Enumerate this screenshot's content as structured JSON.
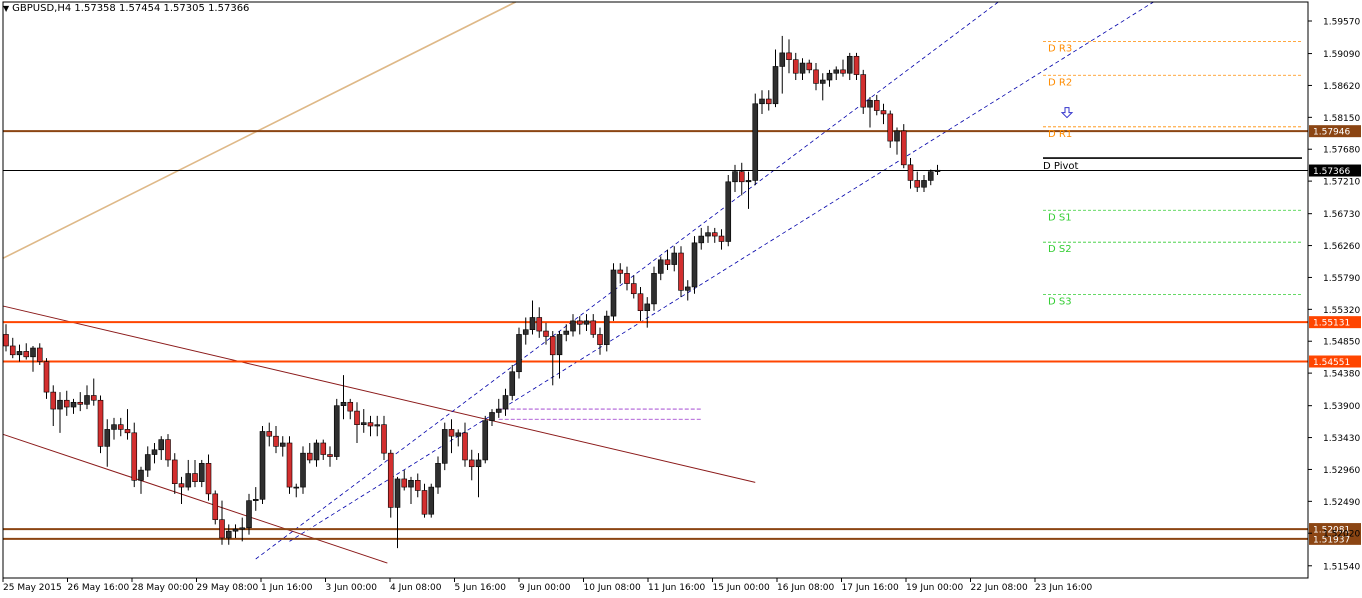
{
  "chart_data": {
    "type": "candlestick",
    "symbol": "GBPUSD,H4",
    "ohlc_header": [
      "1.57358",
      "1.57454",
      "1.57305",
      "1.57366"
    ],
    "ylim": [
      1.5136,
      1.5985
    ],
    "y_ticks": [
      "1.59570",
      "1.59090",
      "1.58620",
      "1.58150",
      "1.57680",
      "1.57210",
      "1.56730",
      "1.56260",
      "1.55790",
      "1.55320",
      "1.54850",
      "1.54380",
      "1.53900",
      "1.53430",
      "1.52960",
      "1.52490",
      "1.52020",
      "1.51540"
    ],
    "x_labels": [
      "25 May 2015",
      "26 May 16:00",
      "28 May 00:00",
      "29 May 08:00",
      "1 Jun 16:00",
      "3 Jun 00:00",
      "4 Jun 08:00",
      "5 Jun 16:00",
      "9 Jun 00:00",
      "10 Jun 08:00",
      "11 Jun 16:00",
      "15 Jun 00:00",
      "16 Jun 08:00",
      "17 Jun 16:00",
      "19 Jun 00:00",
      "22 Jun 08:00",
      "23 Jun 16:00"
    ],
    "horizontal_levels": [
      {
        "value": 1.57946,
        "label": "1.57946",
        "color": "#8b4513"
      },
      {
        "value": 1.57366,
        "label": "1.57366",
        "color": "#000000"
      },
      {
        "value": 1.55131,
        "label": "1.55131",
        "color": "#ff4500"
      },
      {
        "value": 1.54551,
        "label": "1.54551",
        "color": "#ff4500"
      },
      {
        "value": 1.52081,
        "label": "1.52081",
        "color": "#8b4513"
      },
      {
        "value": 1.51937,
        "label": "1.51937",
        "color": "#8b4513"
      }
    ],
    "pivots": [
      {
        "label": "D R3",
        "value": 1.5927,
        "color": "#ff8c00"
      },
      {
        "label": "D R2",
        "value": 1.5877,
        "color": "#ff8c00"
      },
      {
        "label": "D R1",
        "value": 1.5801,
        "color": "#ff8c00"
      },
      {
        "label": "D Pivot",
        "value": 1.5755,
        "color": "#000000"
      },
      {
        "label": "D S1",
        "value": 1.5678,
        "color": "#32cd32"
      },
      {
        "label": "D S2",
        "value": 1.5631,
        "color": "#32cd32"
      },
      {
        "label": "D S3",
        "value": 1.5554,
        "color": "#32cd32"
      }
    ],
    "candles": [
      [
        1.5495,
        1.551,
        1.547,
        1.5478
      ],
      [
        1.5478,
        1.549,
        1.546,
        1.5465
      ],
      [
        1.5465,
        1.548,
        1.5455,
        1.547
      ],
      [
        1.547,
        1.5482,
        1.5458,
        1.5462
      ],
      [
        1.5462,
        1.5478,
        1.544,
        1.5475
      ],
      [
        1.5475,
        1.5482,
        1.545,
        1.5455
      ],
      [
        1.5455,
        1.546,
        1.54,
        1.541
      ],
      [
        1.541,
        1.542,
        1.536,
        1.5385
      ],
      [
        1.5385,
        1.541,
        1.535,
        1.5398
      ],
      [
        1.5398,
        1.5412,
        1.5375,
        1.5388
      ],
      [
        1.5388,
        1.54,
        1.5378,
        1.5395
      ],
      [
        1.5395,
        1.541,
        1.5382,
        1.5392
      ],
      [
        1.5392,
        1.542,
        1.5385,
        1.5405
      ],
      [
        1.5405,
        1.543,
        1.539,
        1.5398
      ],
      [
        1.5398,
        1.5405,
        1.532,
        1.533
      ],
      [
        1.533,
        1.537,
        1.53,
        1.5355
      ],
      [
        1.5355,
        1.5372,
        1.534,
        1.5362
      ],
      [
        1.5362,
        1.5372,
        1.5345,
        1.5355
      ],
      [
        1.5355,
        1.5385,
        1.534,
        1.535
      ],
      [
        1.535,
        1.5365,
        1.527,
        1.528
      ],
      [
        1.528,
        1.53,
        1.526,
        1.5295
      ],
      [
        1.5295,
        1.533,
        1.5285,
        1.5318
      ],
      [
        1.5318,
        1.5335,
        1.5305,
        1.5325
      ],
      [
        1.5325,
        1.5345,
        1.531,
        1.534
      ],
      [
        1.534,
        1.5348,
        1.53,
        1.531
      ],
      [
        1.531,
        1.532,
        1.526,
        1.5275
      ],
      [
        1.5275,
        1.5285,
        1.5245,
        1.527
      ],
      [
        1.527,
        1.531,
        1.5265,
        1.529
      ],
      [
        1.529,
        1.531,
        1.527,
        1.5278
      ],
      [
        1.5278,
        1.531,
        1.527,
        1.5305
      ],
      [
        1.5305,
        1.5318,
        1.525,
        1.526
      ],
      [
        1.526,
        1.5265,
        1.5215,
        1.5222
      ],
      [
        1.5222,
        1.525,
        1.5185,
        1.5195
      ],
      [
        1.5195,
        1.5215,
        1.5185,
        1.5205
      ],
      [
        1.5205,
        1.5215,
        1.5195,
        1.5208
      ],
      [
        1.5208,
        1.5225,
        1.519,
        1.521
      ],
      [
        1.521,
        1.526,
        1.52,
        1.525
      ],
      [
        1.525,
        1.527,
        1.5235,
        1.5252
      ],
      [
        1.5252,
        1.536,
        1.5245,
        1.5352
      ],
      [
        1.5352,
        1.5365,
        1.533,
        1.5345
      ],
      [
        1.5345,
        1.536,
        1.532,
        1.533
      ],
      [
        1.533,
        1.5345,
        1.5315,
        1.5335
      ],
      [
        1.5335,
        1.5345,
        1.526,
        1.527
      ],
      [
        1.527,
        1.5275,
        1.5255,
        1.527
      ],
      [
        1.527,
        1.533,
        1.526,
        1.532
      ],
      [
        1.532,
        1.5335,
        1.5305,
        1.531
      ],
      [
        1.531,
        1.534,
        1.53,
        1.5335
      ],
      [
        1.5335,
        1.534,
        1.531,
        1.5318
      ],
      [
        1.5318,
        1.533,
        1.53,
        1.5315
      ],
      [
        1.5315,
        1.54,
        1.531,
        1.539
      ],
      [
        1.539,
        1.5435,
        1.537,
        1.5395
      ],
      [
        1.5395,
        1.54,
        1.537,
        1.5382
      ],
      [
        1.5382,
        1.5395,
        1.5335,
        1.5362
      ],
      [
        1.5362,
        1.5385,
        1.535,
        1.5365
      ],
      [
        1.5365,
        1.5375,
        1.5345,
        1.536
      ],
      [
        1.536,
        1.5375,
        1.5345,
        1.5362
      ],
      [
        1.5362,
        1.5375,
        1.531,
        1.532
      ],
      [
        1.532,
        1.5325,
        1.5225,
        1.524
      ],
      [
        1.524,
        1.5285,
        1.518,
        1.5282
      ],
      [
        1.5282,
        1.5295,
        1.5265,
        1.527
      ],
      [
        1.527,
        1.5285,
        1.5245,
        1.528
      ],
      [
        1.528,
        1.529,
        1.5255,
        1.5265
      ],
      [
        1.5265,
        1.5275,
        1.5225,
        1.523
      ],
      [
        1.523,
        1.5275,
        1.5225,
        1.527
      ],
      [
        1.527,
        1.5315,
        1.526,
        1.5305
      ],
      [
        1.5305,
        1.5365,
        1.5295,
        1.5355
      ],
      [
        1.5355,
        1.537,
        1.532,
        1.5345
      ],
      [
        1.5345,
        1.5355,
        1.533,
        1.535
      ],
      [
        1.535,
        1.5365,
        1.53,
        1.531
      ],
      [
        1.531,
        1.5325,
        1.528,
        1.53
      ],
      [
        1.53,
        1.532,
        1.5255,
        1.531
      ],
      [
        1.531,
        1.5375,
        1.5305,
        1.5368
      ],
      [
        1.5368,
        1.5385,
        1.536,
        1.538
      ],
      [
        1.538,
        1.54,
        1.5372,
        1.5385
      ],
      [
        1.5385,
        1.5415,
        1.5375,
        1.5405
      ],
      [
        1.5405,
        1.545,
        1.5398,
        1.544
      ],
      [
        1.544,
        1.5505,
        1.543,
        1.5495
      ],
      [
        1.5495,
        1.552,
        1.548,
        1.5502
      ],
      [
        1.5502,
        1.5545,
        1.5495,
        1.552
      ],
      [
        1.552,
        1.5535,
        1.549,
        1.55
      ],
      [
        1.55,
        1.5512,
        1.548,
        1.5492
      ],
      [
        1.5492,
        1.55,
        1.542,
        1.5465
      ],
      [
        1.5465,
        1.55,
        1.543,
        1.5495
      ],
      [
        1.5495,
        1.551,
        1.5485,
        1.55
      ],
      [
        1.55,
        1.5525,
        1.5492,
        1.5515
      ],
      [
        1.5515,
        1.5522,
        1.5495,
        1.551
      ],
      [
        1.551,
        1.5525,
        1.55,
        1.5515
      ],
      [
        1.5515,
        1.5525,
        1.549,
        1.5495
      ],
      [
        1.5495,
        1.5505,
        1.5465,
        1.548
      ],
      [
        1.548,
        1.553,
        1.547,
        1.5522
      ],
      [
        1.5522,
        1.56,
        1.5515,
        1.559
      ],
      [
        1.559,
        1.56,
        1.557,
        1.5585
      ],
      [
        1.5585,
        1.5595,
        1.556,
        1.557
      ],
      [
        1.557,
        1.5582,
        1.5548,
        1.5555
      ],
      [
        1.5555,
        1.5565,
        1.5515,
        1.553
      ],
      [
        1.553,
        1.555,
        1.5505,
        1.554
      ],
      [
        1.554,
        1.5595,
        1.553,
        1.5585
      ],
      [
        1.5585,
        1.561,
        1.5575,
        1.5605
      ],
      [
        1.5605,
        1.562,
        1.559,
        1.5598
      ],
      [
        1.5598,
        1.5625,
        1.5588,
        1.5615
      ],
      [
        1.5615,
        1.5625,
        1.555,
        1.556
      ],
      [
        1.556,
        1.5575,
        1.5545,
        1.5565
      ],
      [
        1.5565,
        1.564,
        1.5555,
        1.563
      ],
      [
        1.563,
        1.5652,
        1.562,
        1.564
      ],
      [
        1.564,
        1.5655,
        1.563,
        1.5645
      ],
      [
        1.5645,
        1.5652,
        1.563,
        1.564
      ],
      [
        1.564,
        1.565,
        1.562,
        1.5632
      ],
      [
        1.5632,
        1.573,
        1.5625,
        1.572
      ],
      [
        1.572,
        1.5745,
        1.5705,
        1.5735
      ],
      [
        1.5735,
        1.5748,
        1.57,
        1.572
      ],
      [
        1.572,
        1.5735,
        1.568,
        1.5722
      ],
      [
        1.5722,
        1.585,
        1.5715,
        1.5835
      ],
      [
        1.5835,
        1.5855,
        1.582,
        1.5842
      ],
      [
        1.5842,
        1.5855,
        1.5825,
        1.5835
      ],
      [
        1.5835,
        1.5915,
        1.583,
        1.589
      ],
      [
        1.589,
        1.5935,
        1.585,
        1.591
      ],
      [
        1.591,
        1.593,
        1.588,
        1.59
      ],
      [
        1.59,
        1.591,
        1.587,
        1.588
      ],
      [
        1.588,
        1.5902,
        1.587,
        1.5895
      ],
      [
        1.5895,
        1.59,
        1.588,
        1.5885
      ],
      [
        1.5885,
        1.5895,
        1.5855,
        1.5865
      ],
      [
        1.5865,
        1.588,
        1.584,
        1.587
      ],
      [
        1.587,
        1.5885,
        1.586,
        1.588
      ],
      [
        1.588,
        1.589,
        1.587,
        1.5885
      ],
      [
        1.5885,
        1.59,
        1.5875,
        1.588
      ],
      [
        1.588,
        1.591,
        1.587,
        1.5905
      ],
      [
        1.5905,
        1.591,
        1.587,
        1.5878
      ],
      [
        1.5878,
        1.5885,
        1.582,
        1.583
      ],
      [
        1.583,
        1.5845,
        1.58,
        1.584
      ],
      [
        1.584,
        1.5848,
        1.5818,
        1.5825
      ],
      [
        1.5825,
        1.5835,
        1.5805,
        1.582
      ],
      [
        1.582,
        1.5825,
        1.577,
        1.578
      ],
      [
        1.578,
        1.58,
        1.576,
        1.5795
      ],
      [
        1.5795,
        1.5805,
        1.574,
        1.5745
      ],
      [
        1.5745,
        1.5755,
        1.571,
        1.5722
      ],
      [
        1.5722,
        1.5735,
        1.5705,
        1.5712
      ],
      [
        1.5712,
        1.573,
        1.5705,
        1.5722
      ],
      [
        1.5722,
        1.5738,
        1.5715,
        1.5735
      ],
      [
        1.5735,
        1.5745,
        1.573,
        1.5737
      ]
    ],
    "colors": {
      "bull": "#2f2f2f",
      "bear": "#d32f2f",
      "wick": "#000000",
      "channel": "#0000aa",
      "trend_down": "#8b1a1a",
      "trend_up": "#deb887",
      "box": "#9932cc",
      "arrow": "#3333cc"
    }
  }
}
